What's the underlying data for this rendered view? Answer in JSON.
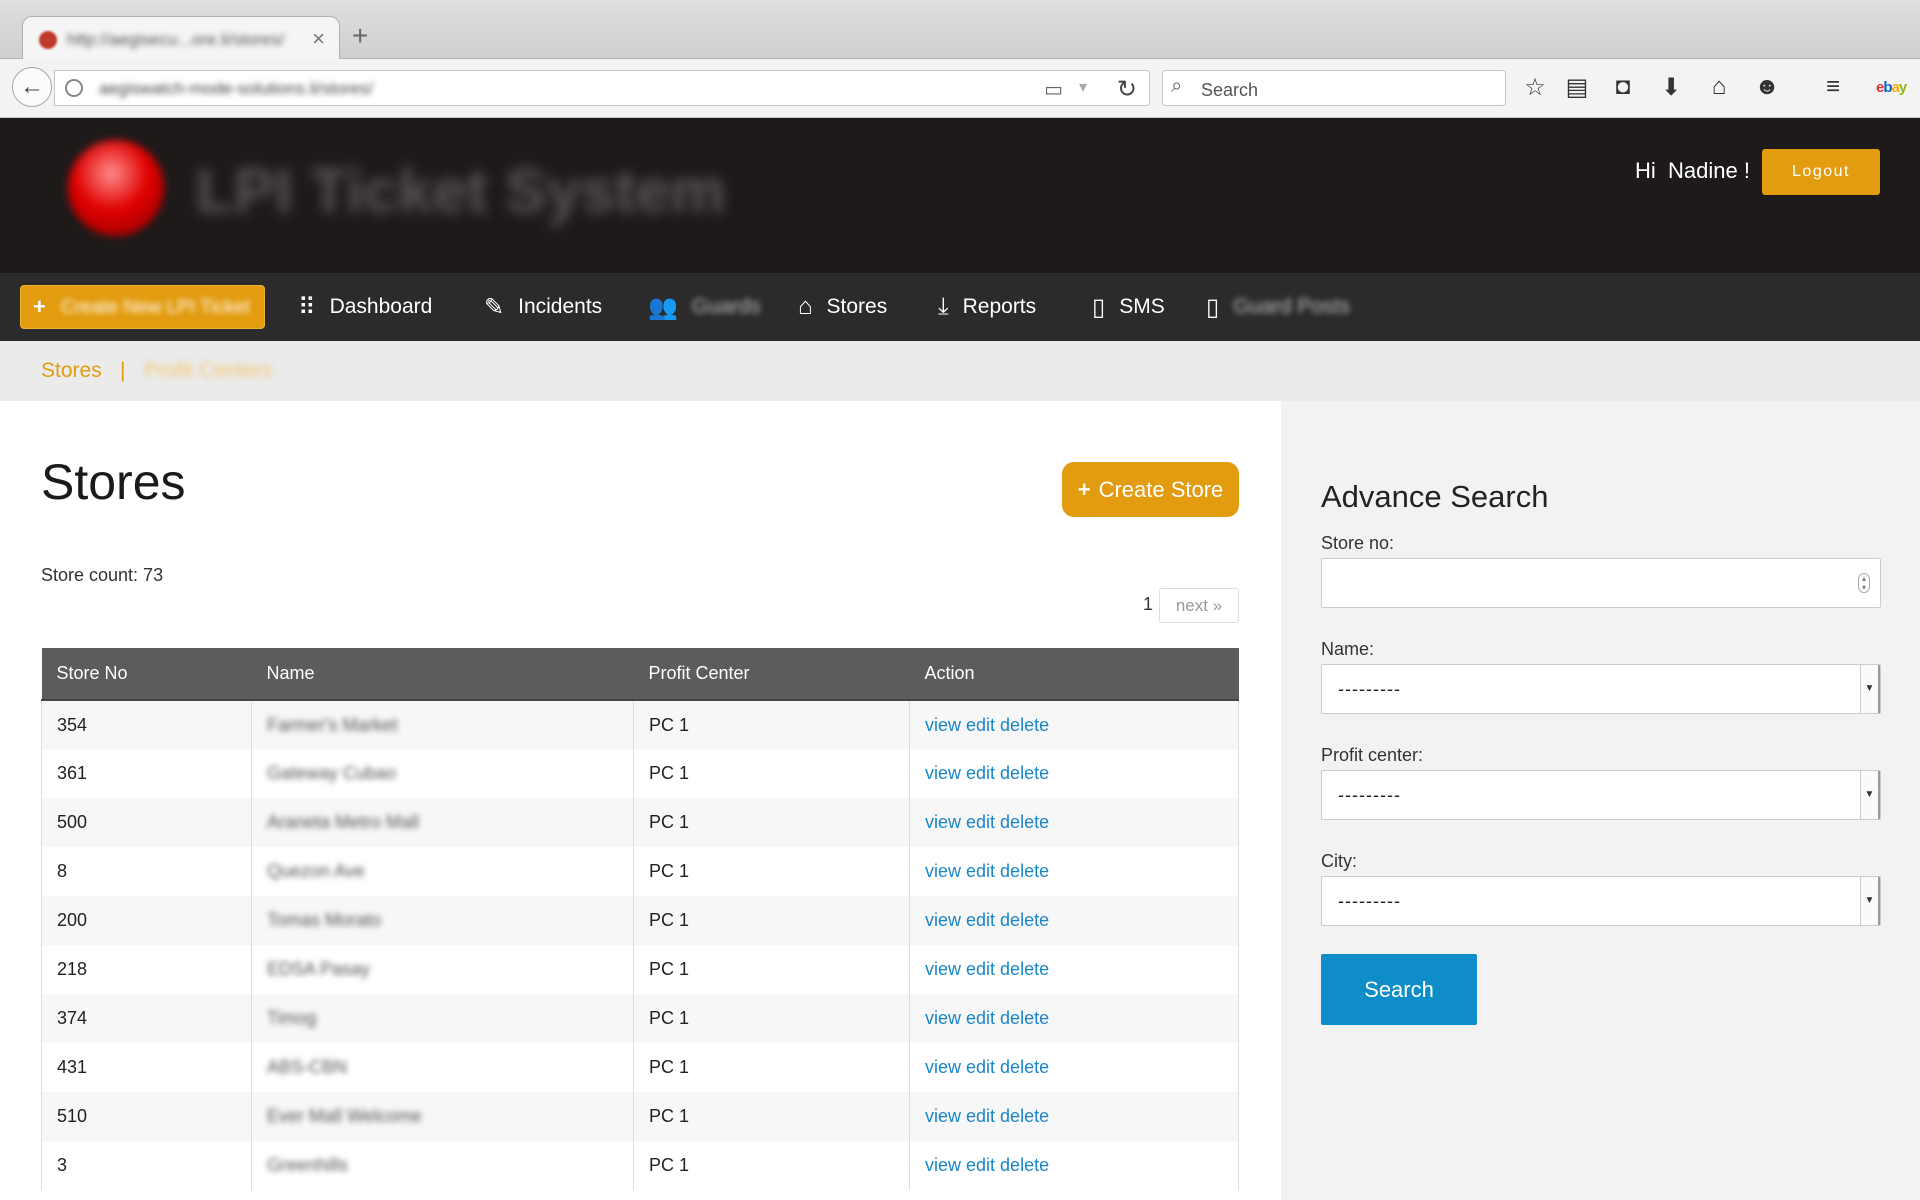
{
  "browser": {
    "tab_title": "http://aegisecu...ore.li/stores/",
    "url": "aegiswatch-mode-solutions.li/stores/",
    "search_placeholder": "Search"
  },
  "header": {
    "logo_text": "LPI Ticket System",
    "greeting_hi": "Hi",
    "greeting_name": "Nadine !",
    "logout_label": "Logout"
  },
  "menu": {
    "create_ticket": "Create New LPI Ticket",
    "items": [
      {
        "label": "Dashboard",
        "icon": "grid-icon"
      },
      {
        "label": "Incidents",
        "icon": "edit-icon"
      },
      {
        "label": "Guards",
        "icon": "users-icon"
      },
      {
        "label": "Stores",
        "icon": "home-icon"
      },
      {
        "label": "Reports",
        "icon": "download-icon"
      },
      {
        "label": "SMS",
        "icon": "phone-icon"
      },
      {
        "label": "Guard Posts",
        "icon": "phone-icon"
      }
    ]
  },
  "breadcrumb": {
    "stores": "Stores",
    "separator": "|",
    "profit_centers": "Profit Centers"
  },
  "main": {
    "title": "Stores",
    "create_store_label": "Create Store",
    "store_count": "Store count: 73",
    "pager_current": "1",
    "pager_next": "next »",
    "columns": [
      "Store No",
      "Name",
      "Profit Center",
      "Action"
    ],
    "action_labels": [
      "view",
      "edit",
      "delete"
    ],
    "rows": [
      {
        "store_no": "354",
        "name": "Farmer's Market",
        "profit_center": "PC 1"
      },
      {
        "store_no": "361",
        "name": "Gateway Cubao",
        "profit_center": "PC 1"
      },
      {
        "store_no": "500",
        "name": "Araneta Metro Mall",
        "profit_center": "PC 1"
      },
      {
        "store_no": "8",
        "name": "Quezon Ave",
        "profit_center": "PC 1"
      },
      {
        "store_no": "200",
        "name": "Tomas Morato",
        "profit_center": "PC 1"
      },
      {
        "store_no": "218",
        "name": "EDSA Pasay",
        "profit_center": "PC 1"
      },
      {
        "store_no": "374",
        "name": "Timog",
        "profit_center": "PC 1"
      },
      {
        "store_no": "431",
        "name": "ABS-CBN",
        "profit_center": "PC 1"
      },
      {
        "store_no": "510",
        "name": "Ever Mall Welcome",
        "profit_center": "PC 1"
      },
      {
        "store_no": "3",
        "name": "Greenhills",
        "profit_center": "PC 1"
      }
    ]
  },
  "sidebar": {
    "title": "Advance Search",
    "store_no_label": "Store no:",
    "store_no_value": "",
    "name_label": "Name:",
    "name_value": "---------",
    "profit_center_label": "Profit center:",
    "profit_center_value": "---------",
    "city_label": "City:",
    "city_value": "---------",
    "search_label": "Search"
  },
  "colors": {
    "accent": "#e39b0f",
    "header_bg": "#1e1a1a",
    "menu_bg": "#2b2b2b",
    "link": "#1a86c8",
    "search_button": "#0e8dc9"
  }
}
